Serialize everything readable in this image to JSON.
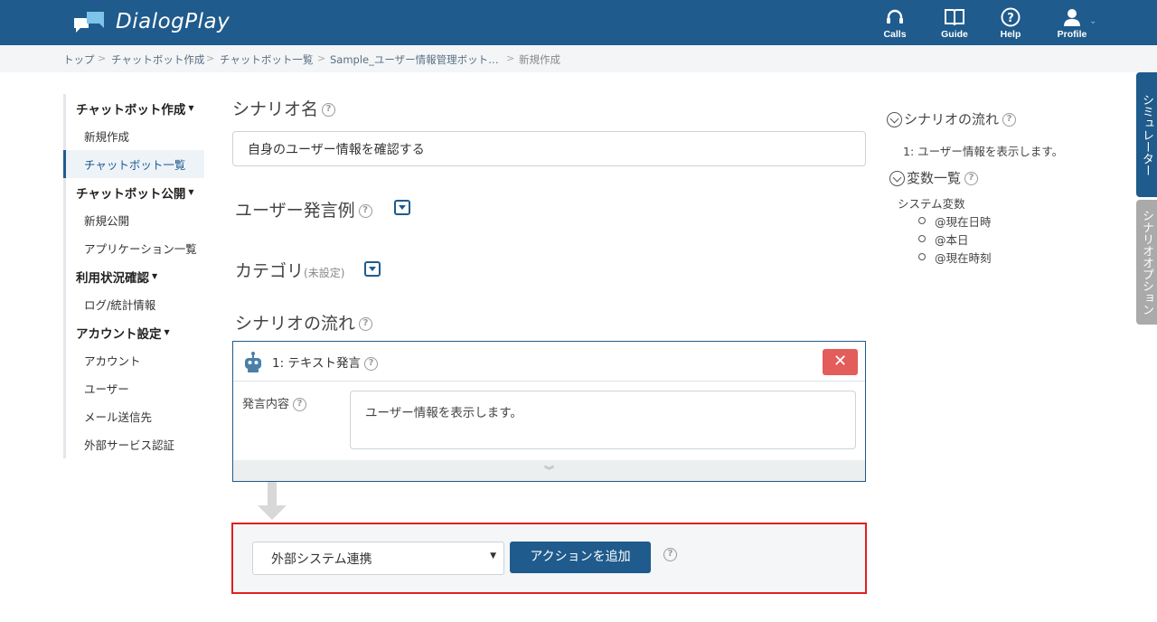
{
  "header": {
    "brand": "DialogPlay",
    "nav": [
      {
        "label": "Calls",
        "icon": "headset-icon"
      },
      {
        "label": "Guide",
        "icon": "book-icon"
      },
      {
        "label": "Help",
        "icon": "help-icon"
      },
      {
        "label": "Profile",
        "icon": "user-icon"
      }
    ]
  },
  "breadcrumb": [
    "トップ",
    "チャットボット作成",
    "チャットボット一覧",
    "Sample_ユーザー情報管理ボット…",
    "新規作成"
  ],
  "sidebar": {
    "groups": [
      {
        "title": "チャットボット作成",
        "items": [
          "新規作成",
          "チャットボット一覧"
        ]
      },
      {
        "title": "チャットボット公開",
        "items": [
          "新規公開",
          "アプリケーション一覧"
        ]
      },
      {
        "title": "利用状況確認",
        "items": [
          "ログ/統計情報"
        ]
      },
      {
        "title": "アカウント設定",
        "items": [
          "アカウント",
          "ユーザー",
          "メール送信先",
          "外部サービス認証"
        ]
      }
    ]
  },
  "main": {
    "scenario_name_label": "シナリオ名",
    "scenario_name_value": "自身のユーザー情報を確認する",
    "user_utterance_label": "ユーザー発言例",
    "category_label": "カテゴリ",
    "category_status": "(未設定)",
    "flow_label": "シナリオの流れ",
    "step": {
      "title": "1: テキスト発言",
      "content_label": "発言内容",
      "content_value": "ユーザー情報を表示します。",
      "close": "✕"
    },
    "action": {
      "selected": "外部システム連携",
      "add_button": "アクションを追加"
    }
  },
  "right_panel": {
    "flow_title": "シナリオの流れ",
    "flow_item": "1: ユーザー情報を表示します。",
    "vars_title": "変数一覧",
    "system_vars_label": "システム変数",
    "vars": [
      "@現在日時",
      "@本日",
      "@現在時刻"
    ]
  },
  "side_tabs": {
    "simulator": "シミュレーター",
    "options": "シナリオオプション"
  },
  "colors": {
    "primary": "#1f5b8c",
    "danger": "#e35d5b",
    "highlight_border": "#e02020"
  }
}
